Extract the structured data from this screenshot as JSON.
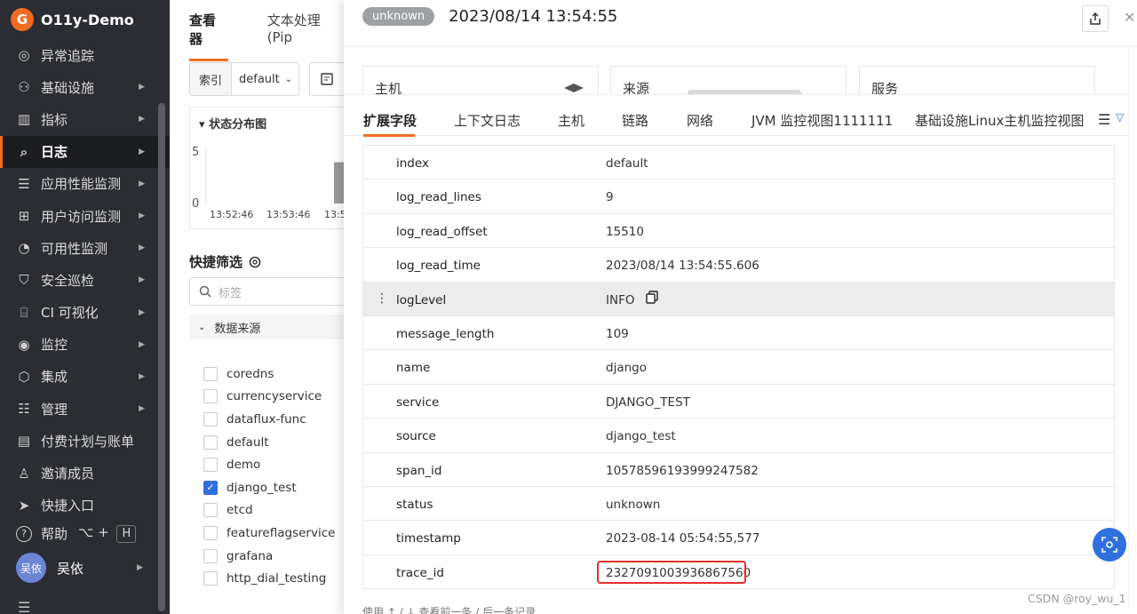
{
  "app": {
    "brand": "O11y-Demo"
  },
  "sidebar": {
    "items": [
      {
        "label": "异常追踪",
        "icon": "target-icon",
        "chevron": false
      },
      {
        "label": "基础设施",
        "icon": "cluster-icon",
        "chevron": true
      },
      {
        "label": "指标",
        "icon": "bar-chart-icon",
        "chevron": true
      },
      {
        "label": "日志",
        "icon": "log-search-icon",
        "chevron": true,
        "active": true
      },
      {
        "label": "应用性能监测",
        "icon": "list-icon",
        "chevron": true
      },
      {
        "label": "用户访问监测",
        "icon": "grid-icon",
        "chevron": true
      },
      {
        "label": "可用性监测",
        "icon": "gauge-icon",
        "chevron": true
      },
      {
        "label": "安全巡检",
        "icon": "shield-icon",
        "chevron": true
      },
      {
        "label": "CI 可视化",
        "icon": "ci-icon",
        "chevron": true
      },
      {
        "label": "监控",
        "icon": "monitor-icon",
        "chevron": true
      },
      {
        "label": "集成",
        "icon": "hexagon-icon",
        "chevron": true
      },
      {
        "label": "管理",
        "icon": "sliders-icon",
        "chevron": true
      },
      {
        "label": "付费计划与账单",
        "icon": "billing-icon",
        "chevron": false
      },
      {
        "label": "邀请成员",
        "icon": "user-add-icon",
        "chevron": false
      },
      {
        "label": "快捷入口",
        "icon": "send-icon",
        "chevron": false
      }
    ],
    "help": {
      "label": "帮助",
      "keys": [
        "⌥",
        "+",
        "H"
      ]
    },
    "user": {
      "avatar_text": "吴依",
      "name": "吴依"
    }
  },
  "middle": {
    "tabs": [
      "查看器",
      "文本处理 (Pip"
    ],
    "index_label": "索引",
    "index_value": "default",
    "distribution_title": "状态分布图",
    "quick_filter_title": "快捷筛选",
    "search_placeholder": "标签",
    "data_source_title": "数据来源",
    "sources": [
      {
        "name": "coredns",
        "checked": false
      },
      {
        "name": "currencyservice",
        "checked": false
      },
      {
        "name": "dataflux-func",
        "checked": false
      },
      {
        "name": "default",
        "checked": false
      },
      {
        "name": "demo",
        "checked": false
      },
      {
        "name": "django_test",
        "checked": true
      },
      {
        "name": "etcd",
        "checked": false
      },
      {
        "name": "featureflagservice",
        "checked": false
      },
      {
        "name": "grafana",
        "checked": false
      },
      {
        "name": "http_dial_testing",
        "checked": false
      }
    ]
  },
  "chart_data": {
    "type": "bar",
    "title": "状态分布图",
    "x": [
      "13:52:46",
      "13:53:46",
      "13:5"
    ],
    "yticks": [
      5,
      0
    ],
    "ylim": [
      0,
      5
    ],
    "series": [
      {
        "values": [
          0,
          0,
          4
        ]
      }
    ]
  },
  "drawer": {
    "status_badge": "unknown",
    "time": "2023/08/14 13:54:55",
    "cards": [
      "主机",
      "来源",
      "服务"
    ],
    "tabs": [
      "扩展字段",
      "上下文日志",
      "主机",
      "链路",
      "网络",
      "JVM 监控视图1111111",
      "基础设施Linux主机监控视图"
    ],
    "fields": [
      {
        "key": "index",
        "value": "default"
      },
      {
        "key": "log_read_lines",
        "value": "9"
      },
      {
        "key": "log_read_offset",
        "value": "15510"
      },
      {
        "key": "log_read_time",
        "value": "2023/08/14 13:54:55.606"
      },
      {
        "key": "logLevel",
        "value": "INFO"
      },
      {
        "key": "message_length",
        "value": "109"
      },
      {
        "key": "name",
        "value": "django"
      },
      {
        "key": "service",
        "value": "DJANGO_TEST"
      },
      {
        "key": "source",
        "value": "django_test"
      },
      {
        "key": "span_id",
        "value": "10578596193999247582"
      },
      {
        "key": "status",
        "value": "unknown"
      },
      {
        "key": "timestamp",
        "value": "2023-08-14 05:54:55,577"
      },
      {
        "key": "trace_id",
        "value": "2327091003936867560"
      }
    ],
    "footer_hint": "使用 ↑ / ↓ 查看前一条 / 后一条记录"
  },
  "watermark": "CSDN @roy_wu_1",
  "colors": {
    "accent": "#f36b21",
    "sidebar_bg": "#2b2d33",
    "primary": "#2f6fde",
    "highlight": "#e0302a"
  }
}
